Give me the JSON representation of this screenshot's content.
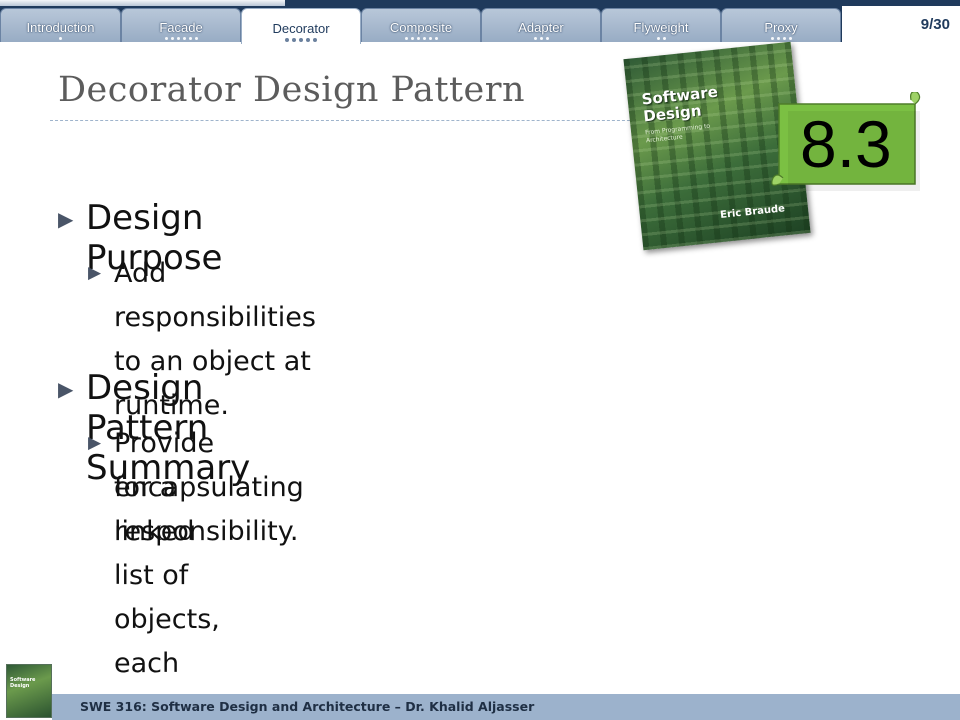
{
  "nav": {
    "tabs": [
      {
        "label": "Introduction",
        "dots": 1
      },
      {
        "label": "Facade",
        "dots": 6
      },
      {
        "label": "Decorator",
        "dots": 5,
        "active": true
      },
      {
        "label": "Composite",
        "dots": 6
      },
      {
        "label": "Adapter",
        "dots": 3
      },
      {
        "label": "Flyweight",
        "dots": 2
      },
      {
        "label": "Proxy",
        "dots": 4
      }
    ],
    "page_indicator": "9/30"
  },
  "slide": {
    "title": "Decorator Design Pattern",
    "sections": [
      {
        "heading": "Design Purpose",
        "points": [
          "Add responsibilities to an object at runtime."
        ]
      },
      {
        "heading": "Design Pattern Summary",
        "points": [
          "Provide for a linked list of objects, each",
          "encapsulating responsibility."
        ]
      }
    ]
  },
  "book": {
    "title_line1": "Software",
    "title_line2": "Design",
    "subtitle": "From Programming to Architecture",
    "author": "Eric Braude"
  },
  "chapter_badge": "8.3",
  "footer": {
    "text": "SWE 316: Software Design and Architecture – Dr. Khalid Aljasser"
  },
  "colors": {
    "nav_bar": "#1f3a5c",
    "scroll_fill": "#7bc043",
    "footer": "#9cb2cc",
    "title": "#5c5c5c"
  }
}
